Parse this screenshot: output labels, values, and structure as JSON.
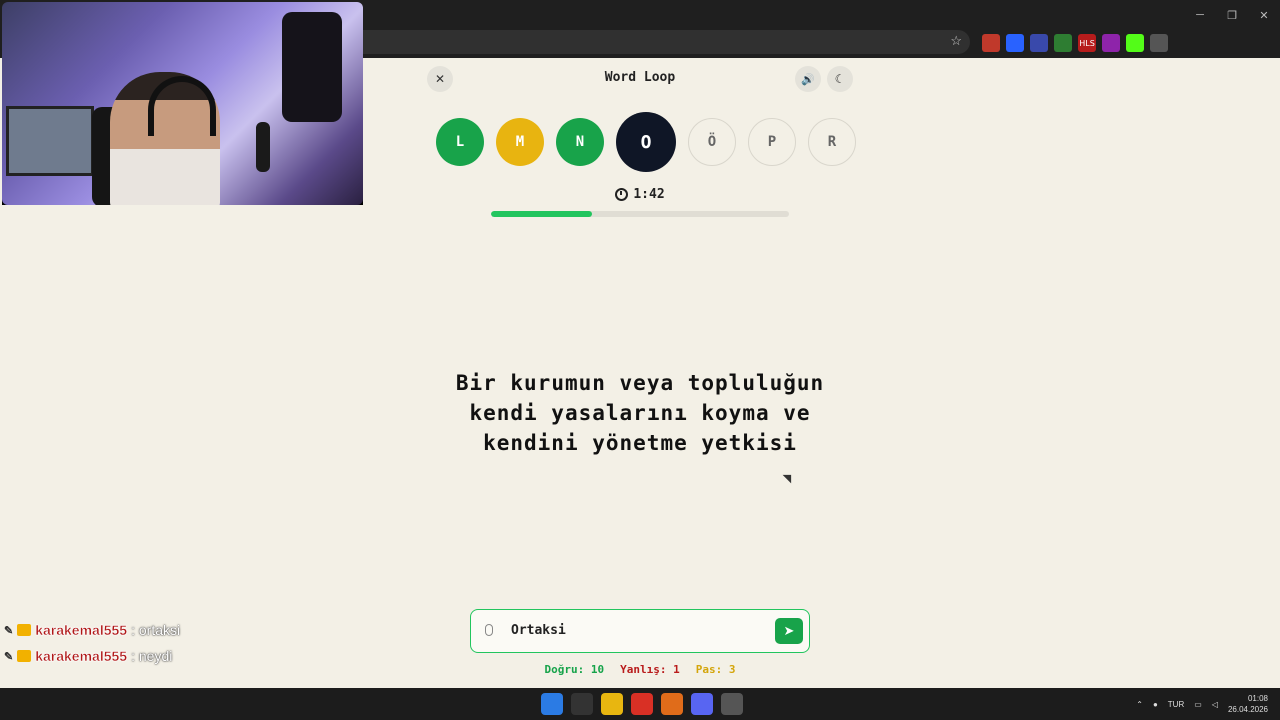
{
  "window": {
    "minimize": "─",
    "restore": "❐",
    "close": "✕"
  },
  "browser": {
    "star": "☆",
    "extensions": [
      {
        "icon": "shield-ext-icon",
        "color": "#c0392b"
      },
      {
        "icon": "translate-ext-icon",
        "color": "#2962ff"
      },
      {
        "icon": "badge-ext-icon",
        "color": "#3949ab"
      },
      {
        "icon": "download-ext-icon",
        "color": "#2e7d32"
      },
      {
        "icon": "hls-ext-icon",
        "color": "#b71c1c",
        "text": "HLS"
      },
      {
        "icon": "app-ext-icon",
        "color": "#8e24aa"
      },
      {
        "icon": "kick-ext-icon",
        "color": "#53fc18"
      },
      {
        "icon": "puzzle-ext-icon",
        "color": "#555555"
      }
    ]
  },
  "game": {
    "title": "Word Loop",
    "close_icon": "✕",
    "sound_icon": "🔊",
    "theme_icon": "☾",
    "letters": [
      {
        "char": "L",
        "state": "green"
      },
      {
        "char": "M",
        "state": "yellow"
      },
      {
        "char": "N",
        "state": "green"
      },
      {
        "char": "O",
        "state": "active"
      },
      {
        "char": "Ö",
        "state": "pending"
      },
      {
        "char": "P",
        "state": "pending"
      },
      {
        "char": "R",
        "state": "pending"
      }
    ],
    "timer": "1:42",
    "progress_percent": 34,
    "question_lines": [
      "Bir kurumun veya topluluğun",
      "kendi yasalarını koyma ve",
      "kendini yönetme yetkisi"
    ],
    "answer": "Ortaksi",
    "send_icon": "➤",
    "stats": {
      "correct": "Doğru: 10",
      "wrong": "Yanlış: 1",
      "pass": "Pas: 3"
    },
    "colors": {
      "green": "#18a34a",
      "yellow": "#e8b410",
      "active": "#0f1626",
      "background": "#f3f0e6"
    }
  },
  "chat": [
    {
      "user": "karakemal555",
      "message": ": ortaksi"
    },
    {
      "user": "karakemal555",
      "message": ": neydi"
    }
  ],
  "taskbar": {
    "apps": [
      "start-icon",
      "search-icon",
      "folder-icon",
      "chrome-icon",
      "app-icon",
      "discord-icon",
      "settings-icon"
    ],
    "lang": "TUR",
    "time": "01:08",
    "date": "26.04.2026"
  }
}
